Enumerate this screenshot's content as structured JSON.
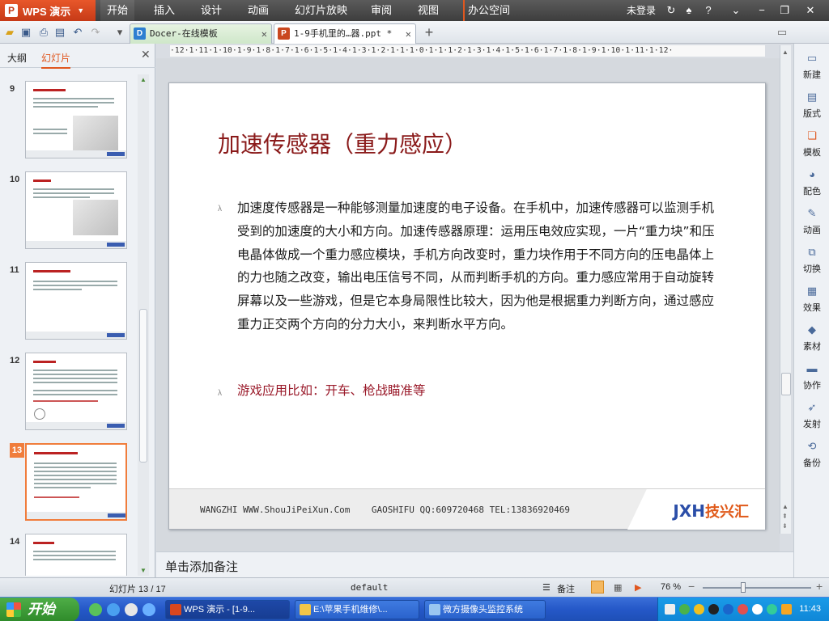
{
  "app": {
    "brand": "WPS 演示",
    "menu": [
      "开始",
      "插入",
      "设计",
      "动画",
      "幻灯片放映",
      "审阅",
      "视图",
      "办公空间"
    ],
    "login": "未登录"
  },
  "tabs": [
    {
      "label": "Docer-在线模板",
      "icon": "D"
    },
    {
      "label": "1-9手机里的…器.ppt *",
      "icon": "P"
    }
  ],
  "left_panel": {
    "tabs": [
      "大纲",
      "幻灯片"
    ],
    "slides": [
      "9",
      "10",
      "11",
      "12",
      "13",
      "14"
    ],
    "selected": "13"
  },
  "ruler": "·12·1·11·1·10·1·9·1·8·1·7·1·6·1·5·1·4·1·3·1·2·1·1·1·0·1·1·1·2·1·3·1·4·1·5·1·6·1·7·1·8·1·9·1·10·1·11·1·12·",
  "slide": {
    "title": "加速传感器（重力感应）",
    "body": "  加速度传感器是一种能够测量加速度的电子设备。在手机中，加速传感器可以监测手机受到的加速度的大小和方向。加速传感器原理：运用压电效应实现，一片“重力块”和压电晶体做成一个重力感应模块，手机方向改变时，重力块作用于不同方向的压电晶体上的力也随之改变，输出电压信号不同，从而判断手机的方向。重力感应常用于自动旋转屏幕以及一些游戏，但是它本身局限性比较大，因为他是根据重力判断方向，通过感应重力正交两个方向的分力大小，来判断水平方向。",
    "sub": "游戏应用比如：开车、枪战瞄准等",
    "footer": "WANGZHI WWW.ShouJiPeiXun.Com    GAOSHIFU QQ:609720468 TEL:13836920469",
    "logo_latin": "JXH",
    "logo_cn": "技兴汇"
  },
  "right_sidebar": [
    "新建",
    "版式",
    "模板",
    "配色",
    "动画",
    "切换",
    "效果",
    "素材",
    "协作",
    "发射",
    "备份"
  ],
  "notes_placeholder": "单击添加备注",
  "status": {
    "slide_counter": "幻灯片 13 / 17",
    "theme": "default",
    "notes_label": "备注",
    "zoom": "76 %",
    "zoom_fraction": 0.37
  },
  "taskbar": {
    "start": "开始",
    "tasks": [
      "WPS 演示 - [1-9...",
      "E:\\苹果手机维修\\...",
      "微方摄像头监控系统"
    ],
    "clock": "11:43"
  }
}
